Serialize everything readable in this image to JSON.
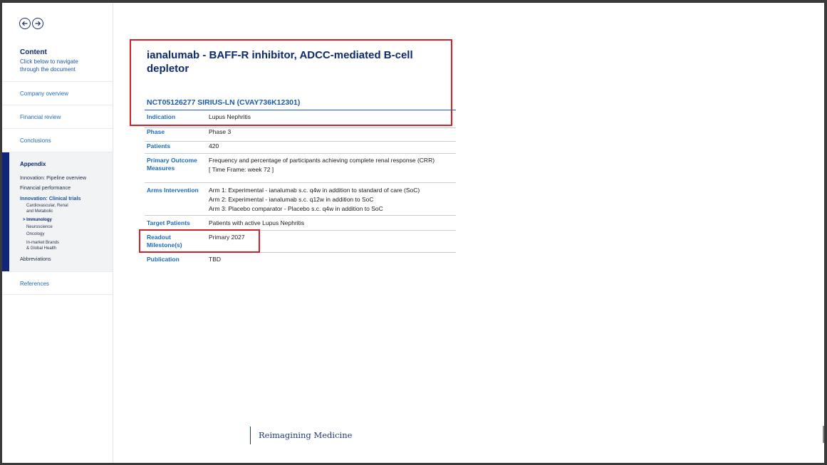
{
  "sidebar": {
    "content_title": "Content",
    "content_subtitle_line1": "Click below to navigate",
    "content_subtitle_line2": "through the document",
    "links": {
      "company_overview": "Company overview",
      "financial_review": "Financial review",
      "conclusions": "Conclusions",
      "references": "References"
    },
    "appendix": {
      "title": "Appendix",
      "items": {
        "pipeline": "Innovation: Pipeline overview",
        "financial_performance": "Financial performance",
        "clinical_trials": "Innovation: Clinical trials",
        "abbreviations": "Abbreviations"
      },
      "subitems": {
        "cardio_1": "Cardiovascular, Renal",
        "cardio_2": "and Metabolic",
        "immunology": "> Immunology",
        "neuroscience": "Neuroscience",
        "oncology": "Oncology",
        "inmarket_1": "In-market Brands",
        "inmarket_2": "& Global Health"
      }
    }
  },
  "main": {
    "title": "ianalumab - BAFF-R inhibitor, ADCC-mediated B-cell depletor",
    "trial_id": "NCT05126277 SIRIUS-LN (CVAY736K12301)",
    "rows": {
      "indication": {
        "label": "Indication",
        "value": "Lupus Nephritis"
      },
      "phase": {
        "label": "Phase",
        "value": "Phase 3"
      },
      "patients": {
        "label": "Patients",
        "value": "420"
      },
      "primary_outcome": {
        "label": "Primary Outcome Measures",
        "value_line1": "Frequency and percentage of participants achieving complete renal response (CRR)",
        "value_line2": "[ Time Frame: week 72 ]"
      },
      "arms": {
        "label": "Arms Intervention",
        "arm1": "Arm 1: Experimental - ianalumab s.c. q4w in addition to standard of care (SoC)",
        "arm2": "Arm 2: Experimental - ianalumab s.c. q12w in addition to SoC",
        "arm3": "Arm 3: Placebo comparator - Placebo s.c. q4w in addition to SoC"
      },
      "target_patients": {
        "label": "Target Patients",
        "value": "Patients with active Lupus Nephritis"
      },
      "readout": {
        "label": "Readout Milestone(s)",
        "value": "Primary 2027"
      },
      "publication": {
        "label": "Publication",
        "value": "TBD"
      }
    }
  },
  "footer": {
    "brand": "Reimagining Medicine"
  },
  "icons": {
    "back": "arrow-left-icon",
    "forward": "arrow-right-icon"
  },
  "colors": {
    "navy": "#0d2a6b",
    "link_blue": "#1d6bb8",
    "highlight_red": "#d42028",
    "appendix_bar": "#10267a"
  }
}
